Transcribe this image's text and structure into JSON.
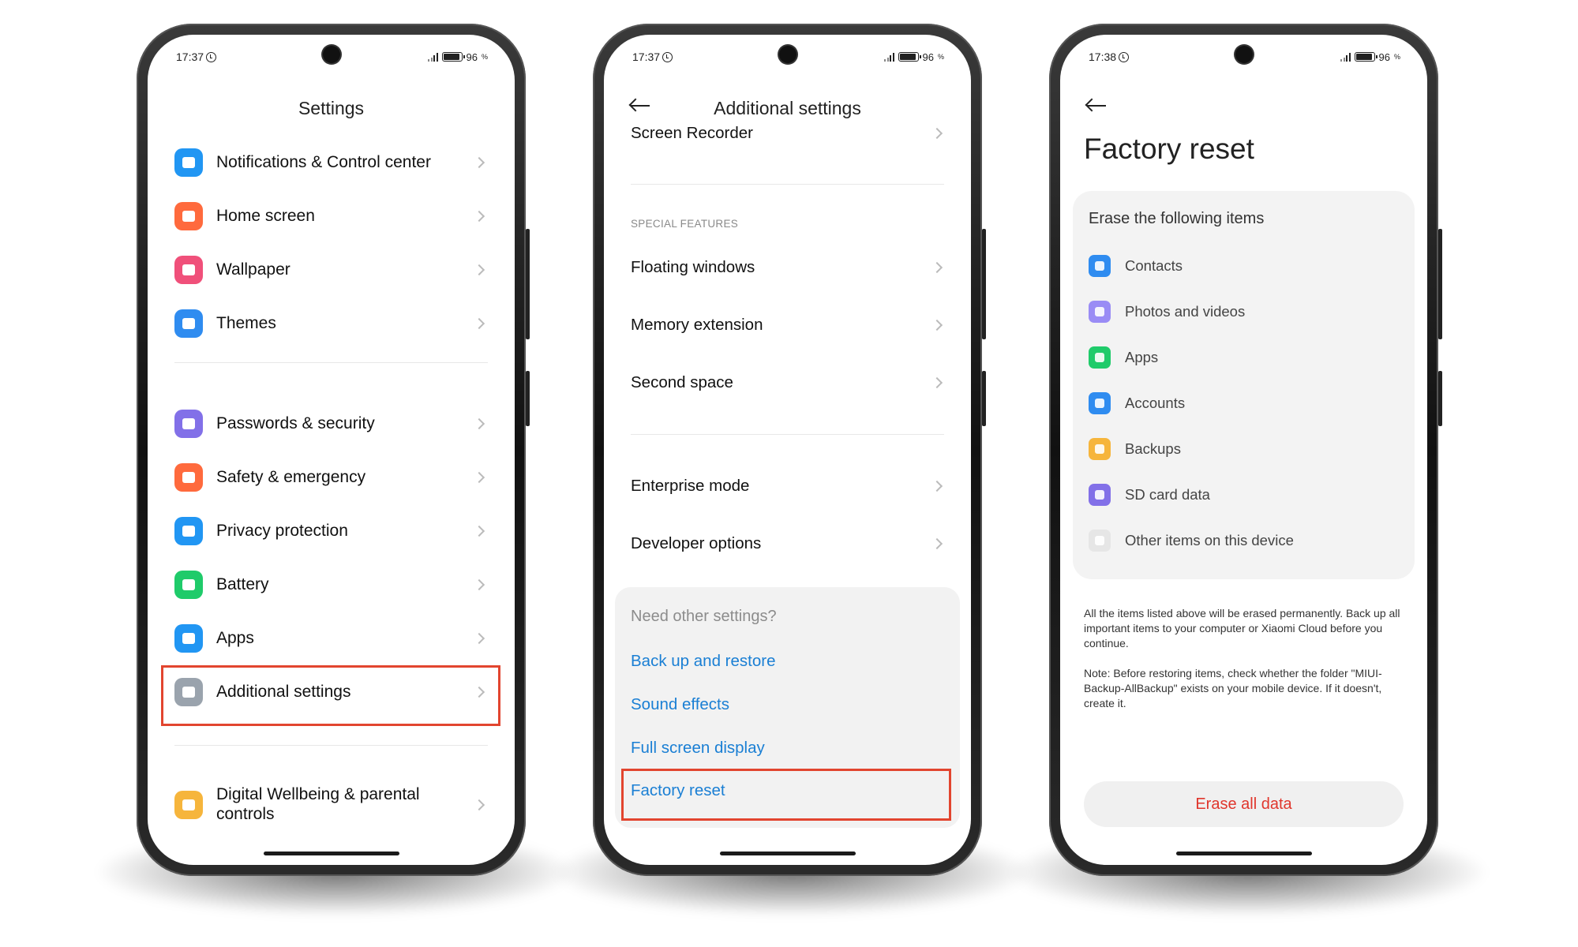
{
  "colors": {
    "highlight": "#e2452f",
    "link_blue": "#1a7fd4",
    "erase_red": "#e0362c"
  },
  "phone1": {
    "status": {
      "time": "17:37",
      "battery": "96"
    },
    "title": "Settings",
    "items": [
      {
        "label": "Notifications & Control center",
        "icon": "notifications-icon",
        "color": "#2196f3"
      },
      {
        "label": "Home screen",
        "icon": "home-icon",
        "color": "#ff6a3d"
      },
      {
        "label": "Wallpaper",
        "icon": "wallpaper-icon",
        "color": "#f0507a"
      },
      {
        "label": "Themes",
        "icon": "themes-icon",
        "color": "#2f8cf0"
      },
      {
        "label": "Passwords & security",
        "icon": "fingerprint-icon",
        "color": "#8270e8"
      },
      {
        "label": "Safety & emergency",
        "icon": "emergency-icon",
        "color": "#ff6a3d"
      },
      {
        "label": "Privacy protection",
        "icon": "privacy-icon",
        "color": "#2196f3"
      },
      {
        "label": "Battery",
        "icon": "battery-icon",
        "color": "#1fcb6a"
      },
      {
        "label": "Apps",
        "icon": "apps-gear-icon",
        "color": "#2196f3"
      },
      {
        "label": "Additional settings",
        "icon": "more-icon",
        "color": "#9aa3ad"
      },
      {
        "label": "Digital Wellbeing & parental controls",
        "icon": "wellbeing-icon",
        "color": "#f6b53c"
      }
    ]
  },
  "phone2": {
    "status": {
      "time": "17:37",
      "battery": "96"
    },
    "title": "Additional settings",
    "top_item": "Screen Recorder",
    "section": "SPECIAL FEATURES",
    "features": [
      "Floating windows",
      "Memory extension",
      "Second space"
    ],
    "bottom_items": [
      "Enterprise mode",
      "Developer options"
    ],
    "other": {
      "heading": "Need other settings?",
      "links": [
        "Back up and restore",
        "Sound effects",
        "Full screen display",
        "Factory reset"
      ]
    }
  },
  "phone3": {
    "status": {
      "time": "17:38",
      "battery": "96"
    },
    "title": "Factory reset",
    "card_heading": "Erase the following items",
    "items": [
      {
        "label": "Contacts",
        "icon": "contacts-icon",
        "color": "#2f8cf0"
      },
      {
        "label": "Photos and videos",
        "icon": "photos-icon",
        "color": "#9a8cf5"
      },
      {
        "label": "Apps",
        "icon": "apps-icon",
        "color": "#1fcb6a"
      },
      {
        "label": "Accounts",
        "icon": "accounts-icon",
        "color": "#2f8cf0"
      },
      {
        "label": "Backups",
        "icon": "backups-icon",
        "color": "#f6b53c"
      },
      {
        "label": "SD card data",
        "icon": "sd-card-icon",
        "color": "#8270e8"
      },
      {
        "label": "Other items on this device",
        "icon": "other-items-icon",
        "color": "#e6e6e6"
      }
    ],
    "note1": "All the items listed above will be erased permanently. Back up all important items to your computer or Xiaomi Cloud before you continue.",
    "note2": "Note: Before restoring items, check whether the folder \"MIUI-Backup-AllBackup\" exists on your mobile device. If it doesn't, create it.",
    "button": "Erase all data"
  }
}
